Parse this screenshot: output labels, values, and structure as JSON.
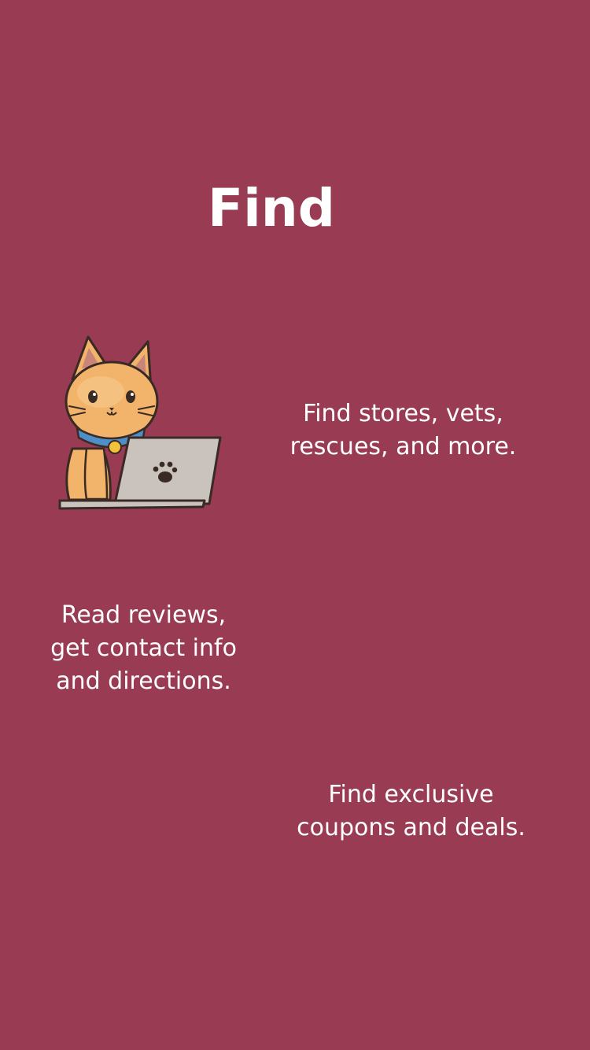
{
  "screen": {
    "title": "Find",
    "features": [
      {
        "text": "Find stores, vets,\nrescues, and more."
      },
      {
        "text": "Read reviews,\nget contact info\nand directions."
      },
      {
        "text": "Find exclusive\ncoupons and deals."
      }
    ],
    "illustration_icon": "cat-with-laptop-icon"
  },
  "colors": {
    "background": "#993b53",
    "text": "#ffffff",
    "cat_fur": "#f2b36b",
    "collar": "#4f8fc9",
    "laptop": "#c9c2bd"
  }
}
